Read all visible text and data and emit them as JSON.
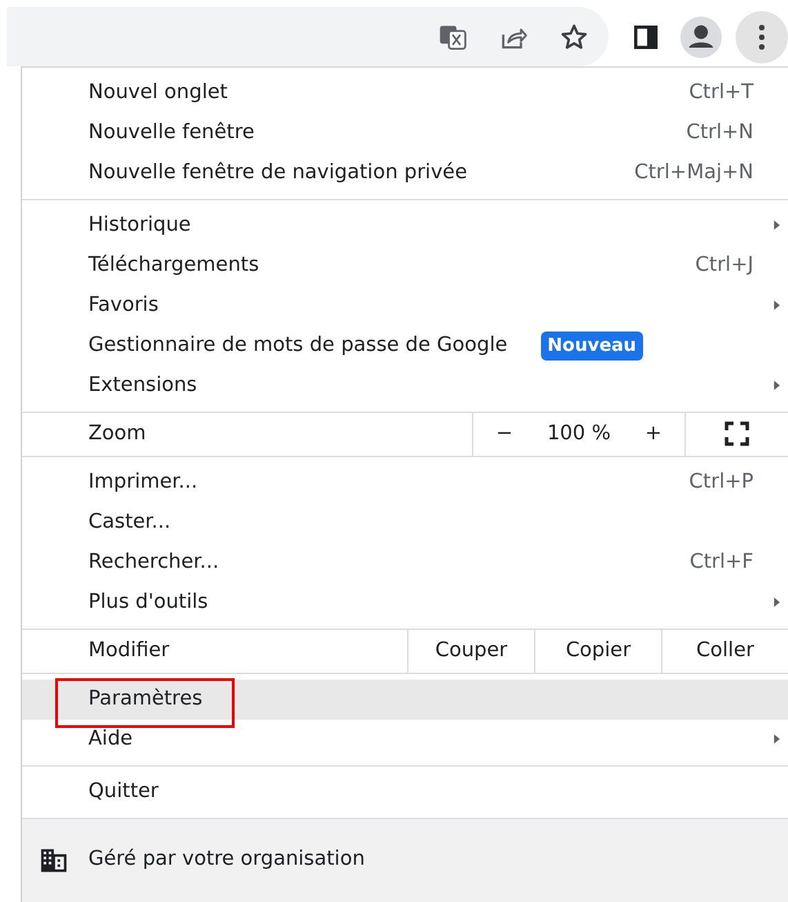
{
  "toolbar": {
    "buttons": [
      {
        "kind": "translate",
        "selected": false
      },
      {
        "kind": "share",
        "selected": false
      },
      {
        "kind": "star",
        "selected": false
      },
      {
        "kind": "sidepanel",
        "selected": false
      },
      {
        "kind": "profile",
        "selected": false
      },
      {
        "kind": "menu",
        "selected": true
      }
    ]
  },
  "menu": {
    "sections": [
      {
        "items": [
          {
            "kind": "item",
            "label": "Nouvel onglet",
            "shortcut": "Ctrl+T",
            "highlighted": false,
            "outlined": false
          },
          {
            "kind": "item",
            "label": "Nouvelle fenêtre",
            "shortcut": "Ctrl+N",
            "highlighted": false,
            "outlined": false
          },
          {
            "kind": "item",
            "label": "Nouvelle fenêtre de navigation privée",
            "shortcut": "Ctrl+Maj+N",
            "highlighted": false,
            "outlined": false
          }
        ]
      },
      {
        "items": [
          {
            "kind": "submenu",
            "label": "Historique",
            "highlighted": false,
            "outlined": false
          },
          {
            "kind": "item",
            "label": "Téléchargements",
            "shortcut": "Ctrl+J",
            "highlighted": false,
            "outlined": false
          },
          {
            "kind": "submenu",
            "label": "Favoris",
            "highlighted": false,
            "outlined": false
          },
          {
            "kind": "item",
            "label": "Gestionnaire de mots de passe de Google",
            "badge": "Nouveau",
            "highlighted": false,
            "outlined": false
          },
          {
            "kind": "submenu",
            "label": "Extensions",
            "highlighted": false,
            "outlined": false
          }
        ]
      },
      {
        "items": [
          {
            "kind": "zoom",
            "label": "Zoom",
            "minus": "−",
            "value": "100 %",
            "plus": "+"
          }
        ]
      },
      {
        "items": [
          {
            "kind": "item",
            "label": "Imprimer...",
            "shortcut": "Ctrl+P",
            "highlighted": false,
            "outlined": false
          },
          {
            "kind": "item",
            "label": "Caster...",
            "highlighted": false,
            "outlined": false
          },
          {
            "kind": "item",
            "label": "Rechercher...",
            "shortcut": "Ctrl+F",
            "highlighted": false,
            "outlined": false
          },
          {
            "kind": "submenu",
            "label": "Plus d'outils",
            "highlighted": false,
            "outlined": false
          }
        ]
      },
      {
        "items": [
          {
            "kind": "edit",
            "label": "Modifier",
            "actions": [
              "Couper",
              "Copier",
              "Coller"
            ]
          }
        ]
      },
      {
        "items": [
          {
            "kind": "item",
            "label": "Paramètres",
            "highlighted": true,
            "outlined": true
          },
          {
            "kind": "submenu",
            "label": "Aide",
            "highlighted": false,
            "outlined": false
          }
        ]
      },
      {
        "items": [
          {
            "kind": "item",
            "label": "Quitter",
            "highlighted": false,
            "outlined": false
          }
        ]
      }
    ],
    "footer": {
      "label": "Géré par votre organisation"
    }
  }
}
